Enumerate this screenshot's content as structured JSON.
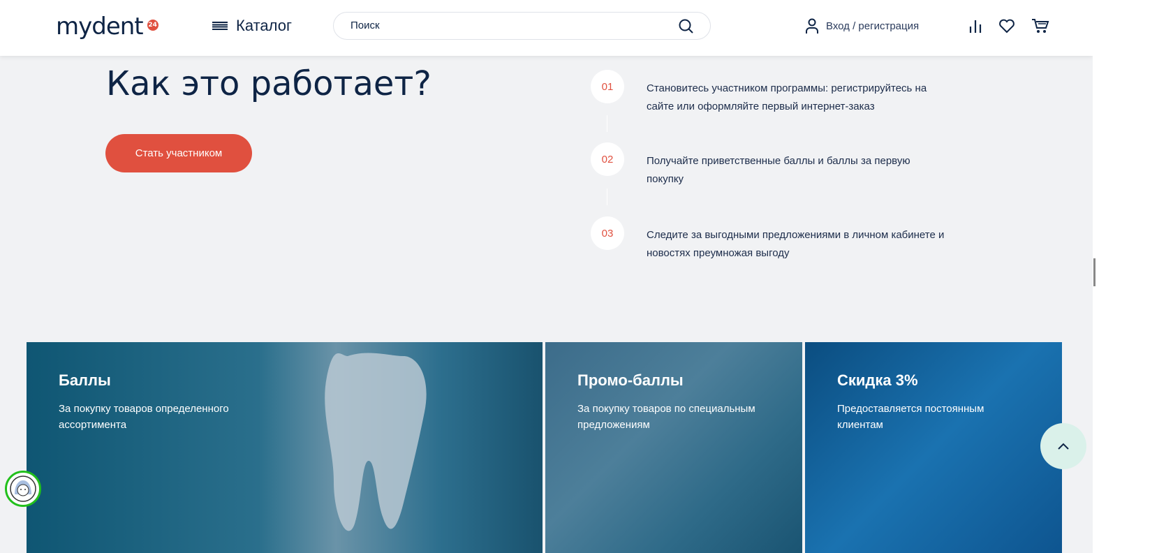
{
  "header": {
    "logo": "mydent",
    "logo_badge": "24",
    "catalog": "Каталог",
    "search_placeholder": "Поиск",
    "login": "Вход / регистрация"
  },
  "hero": {
    "title": "Как это работает?",
    "cta": "Стать участником"
  },
  "steps": [
    {
      "num": "01",
      "text": "Становитесь участником программы: регистрируйтесь на сайте или оформляйте первый интернет-заказ"
    },
    {
      "num": "02",
      "text": "Получайте приветственные баллы и баллы за первую покупку"
    },
    {
      "num": "03",
      "text": "Следите за выгодными предложениями в личном кабинете и новостях преумножая выгоду"
    }
  ],
  "cards": [
    {
      "title": "Баллы",
      "text": "За покупку товаров определенного ассортимента"
    },
    {
      "title": "Промо-баллы",
      "text": "За покупку товаров по специальным предложениям"
    },
    {
      "title": "Скидка 3%",
      "text": "Предоставляется постоянным клиентам"
    }
  ],
  "colors": {
    "accent": "#e0503f",
    "navy": "#0e2445"
  }
}
